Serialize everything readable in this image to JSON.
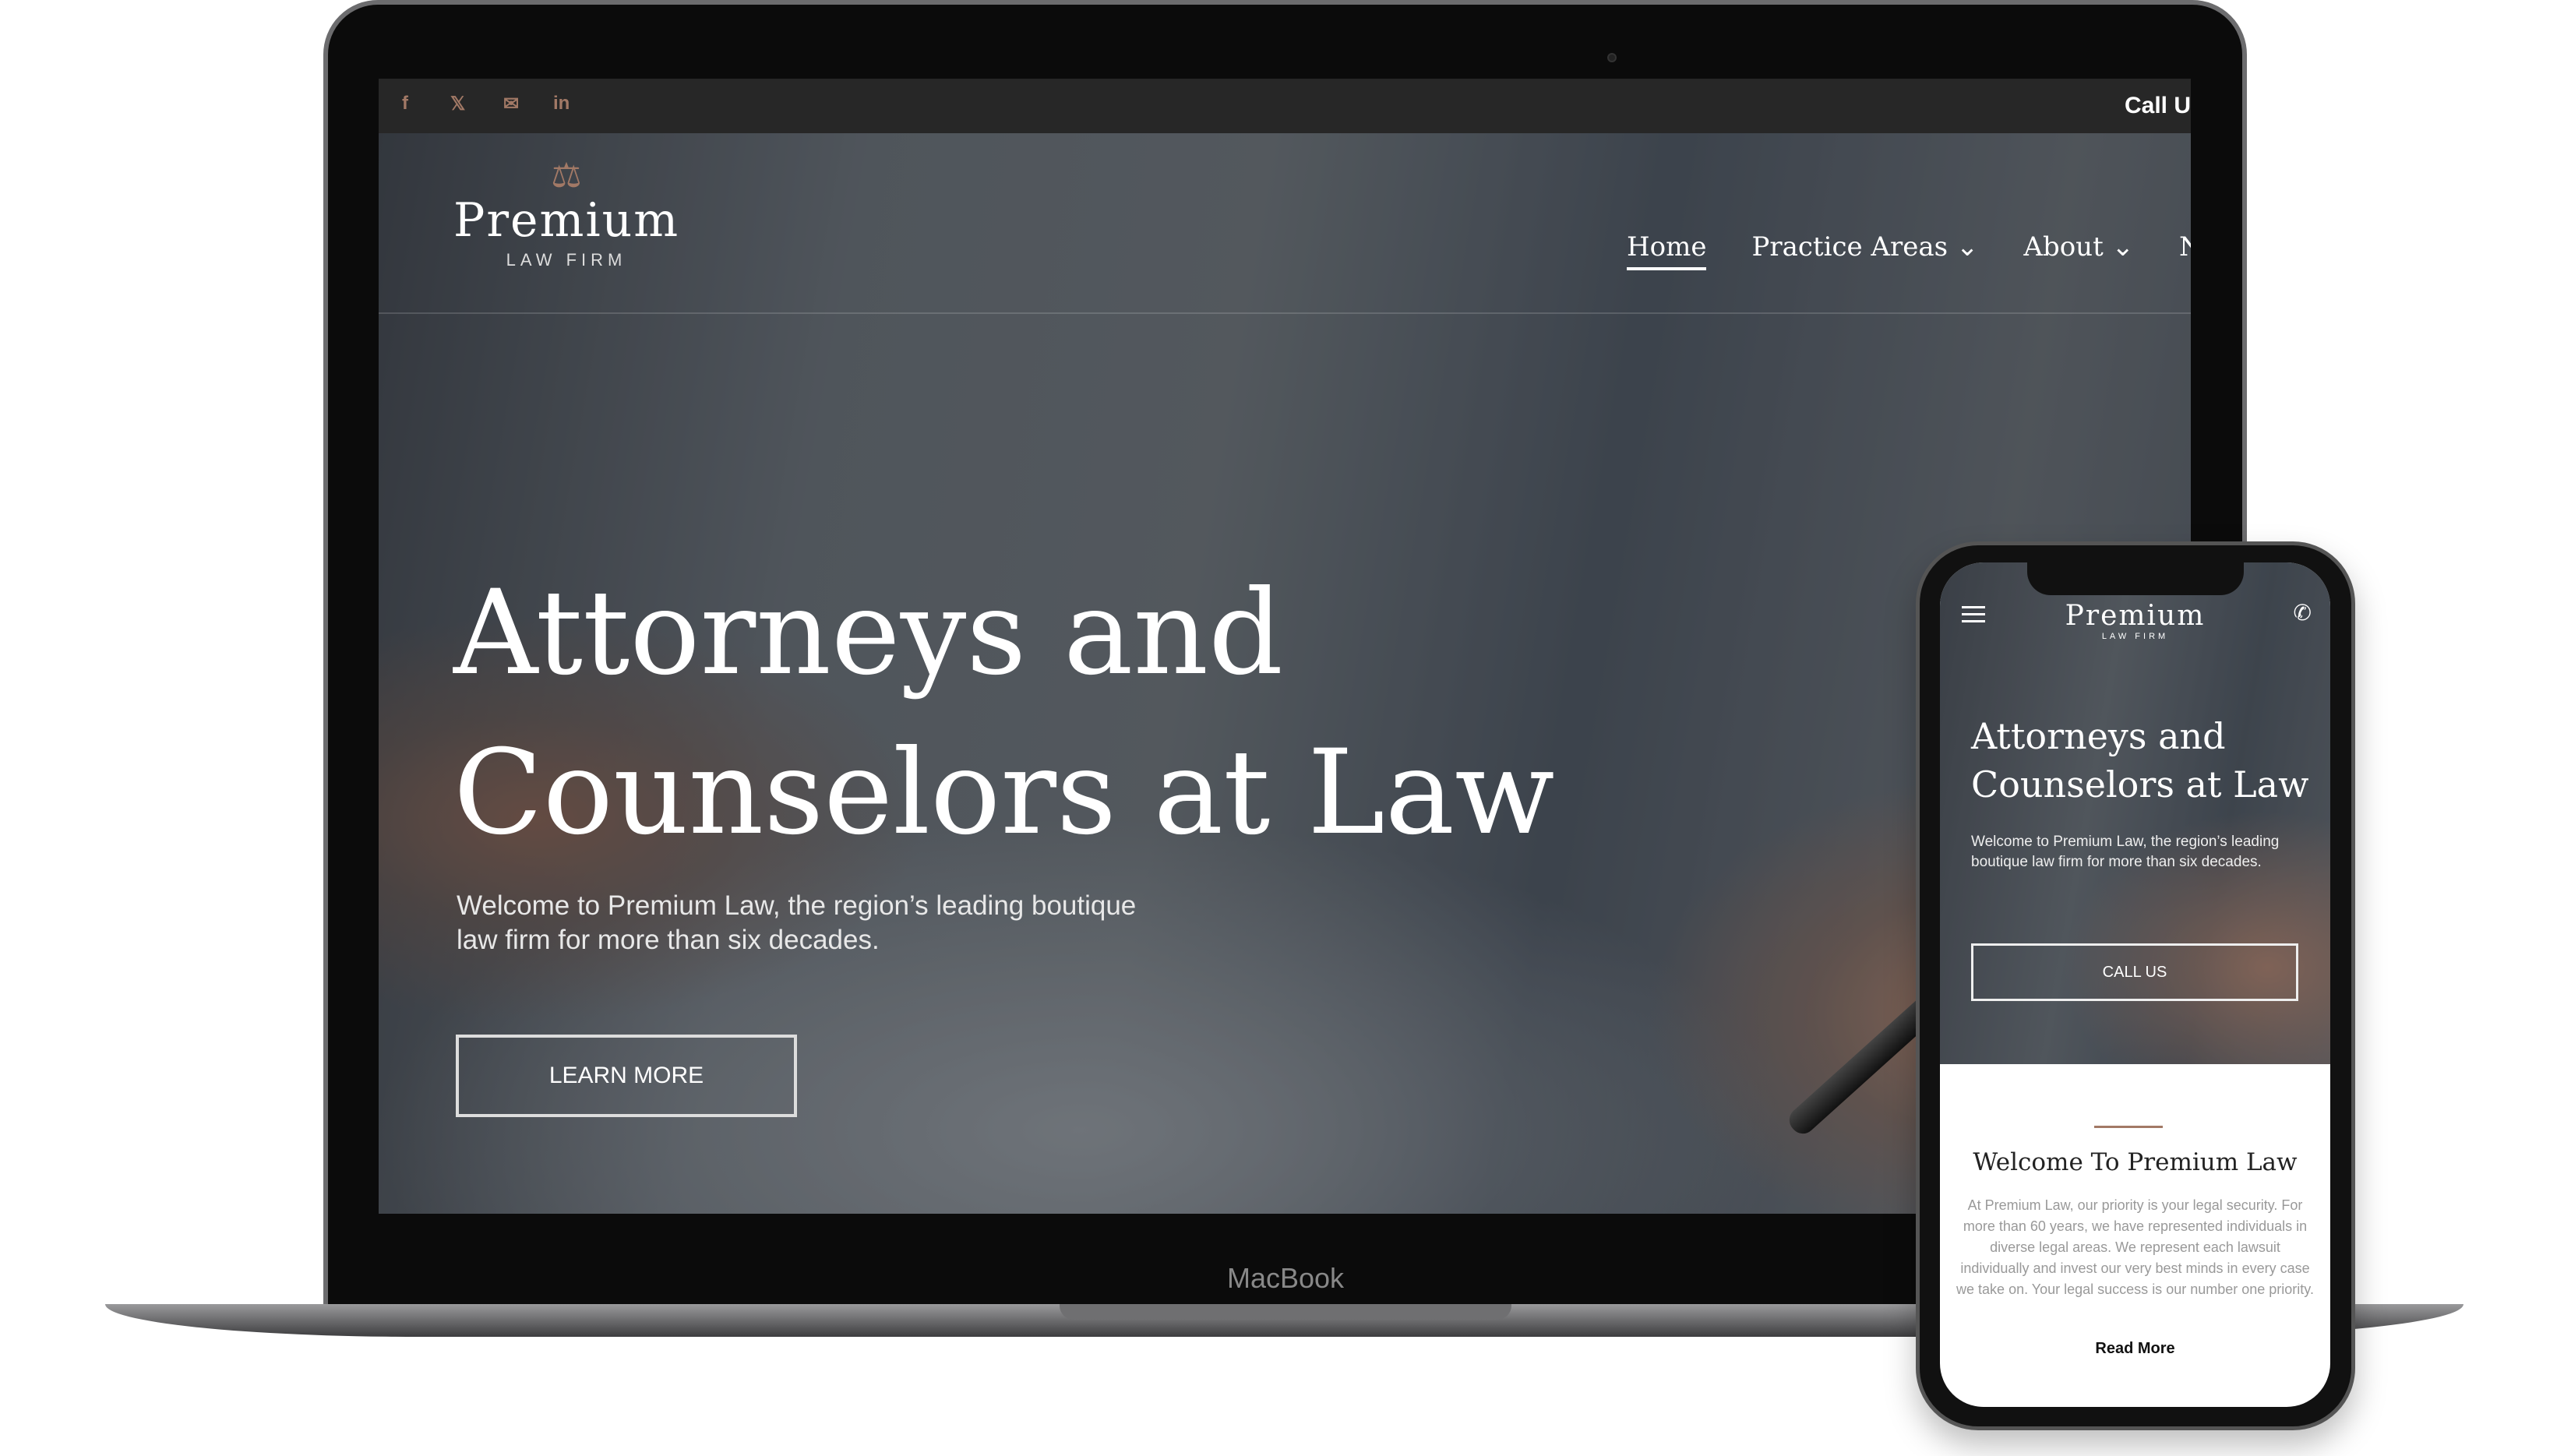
{
  "laptop": {
    "brand_label": "MacBook",
    "topbar": {
      "social_icons": [
        "facebook-icon",
        "twitter-icon",
        "envelope-icon",
        "linkedin-icon"
      ],
      "social_glyphs": [
        "f",
        "🐦",
        "✉",
        "in"
      ],
      "call_text": "Call U"
    },
    "logo": {
      "name": "Premium",
      "tagline": "LAW FIRM",
      "icon": "scales-icon"
    },
    "nav": {
      "items": [
        {
          "label": "Home",
          "active": true
        },
        {
          "label": "Practice Areas ⌄"
        },
        {
          "label": "About ⌄"
        },
        {
          "label": "N"
        }
      ]
    },
    "hero": {
      "title_line1": "Attorneys and",
      "title_line2": "Counselors at Law",
      "lead_line1": "Welcome to Premium Law, the region’s leading boutique",
      "lead_line2": "law firm for more than six decades.",
      "button": "LEARN MORE"
    }
  },
  "phone": {
    "logo": {
      "name": "Premium",
      "tagline": "LAW FIRM"
    },
    "hero": {
      "title_line1": "Attorneys and",
      "title_line2": "Counselors at Law",
      "lead": "Welcome to Premium Law, the region’s leading boutique law firm for more than six decades.",
      "button": "CALL US"
    },
    "welcome": {
      "heading": "Welcome To Premium Law",
      "body": "At Premium Law, our priority is your legal security. For more than 60 years, we have represented individuals in diverse legal areas. We represent each lawsuit individually and invest our very best minds in every case we take on. Your legal success is our number one priority.",
      "link": "Read More"
    }
  },
  "colors": {
    "accent": "#a27966",
    "topbar": "#272727"
  }
}
